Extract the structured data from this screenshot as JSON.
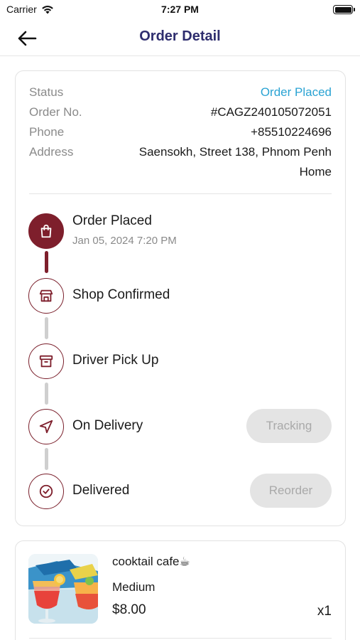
{
  "status_bar": {
    "carrier": "Carrier",
    "time": "7:27 PM"
  },
  "header": {
    "title": "Order Detail",
    "back_icon": "arrow-left-icon"
  },
  "order_info": {
    "status_label": "Status",
    "status_value": "Order Placed",
    "order_no_label": "Order No.",
    "order_no_value": "#CAGZ240105072051",
    "phone_label": "Phone",
    "phone_value": "+85510224696",
    "address_label": "Address",
    "address_line1": "Saensokh, Street 138, Phnom Penh",
    "address_line2": "Home"
  },
  "timeline": [
    {
      "title": "Order Placed",
      "time": "Jan 05, 2024 7:20 PM",
      "icon": "shopping-bag-icon",
      "active": true
    },
    {
      "title": "Shop Confirmed",
      "icon": "store-icon",
      "active": false
    },
    {
      "title": "Driver Pick Up",
      "icon": "package-icon",
      "active": false
    },
    {
      "title": "On Delivery",
      "icon": "navigation-icon",
      "active": false,
      "button": "Tracking"
    },
    {
      "title": "Delivered",
      "icon": "check-circle-icon",
      "active": false,
      "button": "Reorder"
    }
  ],
  "order_item": {
    "name": "cooktail cafe☕",
    "variant": "Medium",
    "price": "$8.00",
    "quantity": "x1",
    "image": "cocktail-drinks-image"
  },
  "colors": {
    "accent": "#7e1f2c",
    "title": "#2e2d6e",
    "status": "#2aa3d3"
  }
}
